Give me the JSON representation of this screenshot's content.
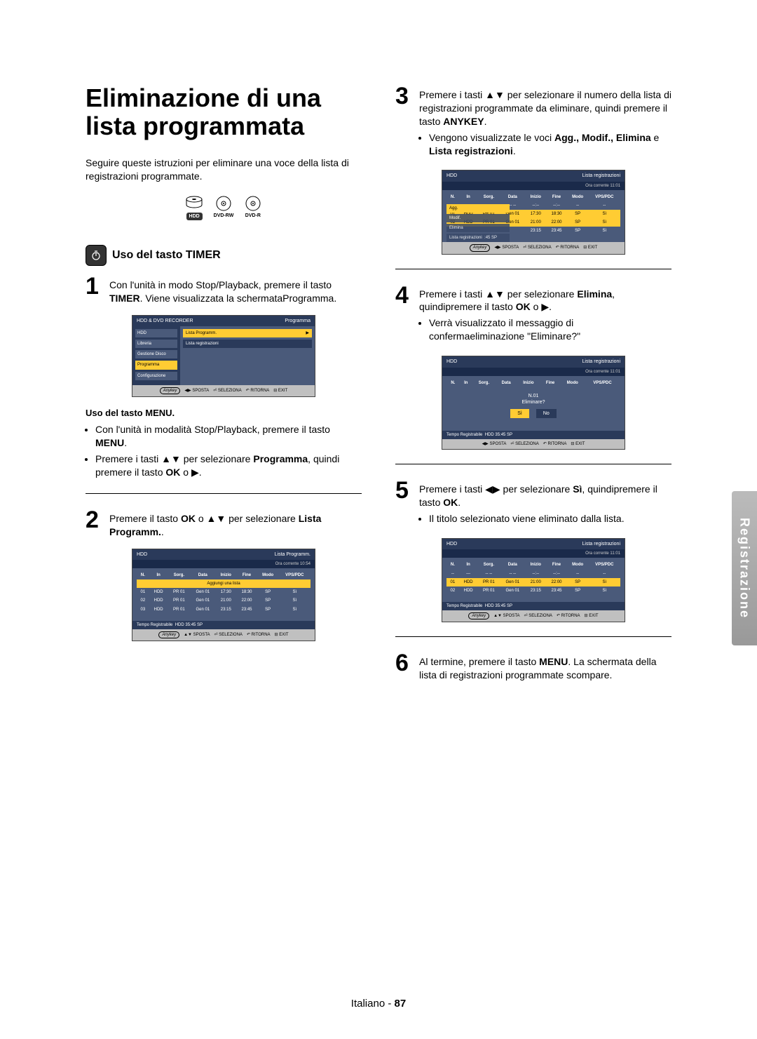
{
  "title": "Eliminazione di una lista programmata",
  "intro": "Seguire queste istruzioni per eliminare una voce della lista di registrazioni programmate.",
  "discs": {
    "hdd": "HDD",
    "dvdrw": "DVD-RW",
    "dvdr": "DVD-R"
  },
  "section_timer": "Uso del tasto TIMER",
  "section_menu_title": "Uso del tasto MENU.",
  "side_tab": "Registrazione",
  "footer_lang": "Italiano -",
  "footer_page": "87",
  "steps": {
    "s1": {
      "text": "Con l'unità in modo Stop/Playback, premere il tasto ",
      "b1": "TIMER",
      "text2": ". Viene visualizzata la schermataProgramma."
    },
    "menu_bullets": {
      "b1a": "Con l'unità in modalità Stop/Playback, premere il tasto ",
      "b1b": "MENU",
      "b1c": ".",
      "b2a": "Premere i tasti ▲▼ per selezionare ",
      "b2b": "Programma",
      "b2c": ", quindi premere il tasto ",
      "b2d": "OK",
      "b2e": " o ▶."
    },
    "s2": {
      "a": "Premere il tasto ",
      "b": "OK",
      "c": " o ▲▼ per selezionare ",
      "d": "Lista Programm.",
      "e": "."
    },
    "s3": {
      "a": "Premere i tasti ▲▼ per selezionare il numero della lista di registrazioni programmate da eliminare, quindi premere il tasto ",
      "b": "ANYKEY",
      "c": ".",
      "bullet_a": "Vengono visualizzate le voci ",
      "bullet_b": "Agg., Modif., Elimina",
      "bullet_c": " e ",
      "bullet_d": "Lista registrazioni",
      "bullet_e": "."
    },
    "s4": {
      "a": "Premere i tasti ▲▼ per selezionare ",
      "b": "Elimina",
      "c": ", quindipremere il tasto ",
      "d": "OK",
      "e": " o ▶.",
      "bullet": "Verrà visualizzato il messaggio di confermaeliminazione \"Eliminare?\""
    },
    "s5": {
      "a": "Premere i tasti ◀▶ per selezionare ",
      "b": "Sì",
      "c": ", quindipremere il tasto ",
      "d": "OK",
      "e": ".",
      "bullet": "Il titolo selezionato viene eliminato dalla lista."
    },
    "s6": {
      "a": "Al termine, premere il tasto ",
      "b": "MENU",
      "c": ". La schermata della lista di registrazioni programmate scompare."
    }
  },
  "osd": {
    "foot_sposta": "SPOSTA",
    "foot_seleziona": "SELEZIONA",
    "foot_ritorna": "RITORNA",
    "foot_exit": "EXIT",
    "anykey": "Anykey",
    "headers": [
      "N.",
      "In",
      "Sorg.",
      "Data",
      "Inizio",
      "Fine",
      "Modo",
      "VPS/PDC"
    ],
    "tempo_label": "Tempo Registrabile",
    "tempo_value": "HDD  35:45 SP",
    "screen1": {
      "title": "HDD & DVD RECORDER",
      "right": "Programma",
      "side": [
        "HDD",
        "Libreria",
        "Gestione Disco",
        "Programma",
        "Configurazione"
      ],
      "rows": [
        "Lista Programm.",
        "Lista registrazioni"
      ]
    },
    "screen2": {
      "title_l": "HDD",
      "title_r": "Lista Programm.",
      "time": "Ora corrente 10:54",
      "addrow": "Aggiungi una lista",
      "rows": [
        [
          "01",
          "HDD",
          "PR 01",
          "Gen 01",
          "17:30",
          "18:30",
          "SP",
          "Sì"
        ],
        [
          "02",
          "HDD",
          "PR 01",
          "Gen 01",
          "21:00",
          "22:00",
          "SP",
          "Sì"
        ],
        [
          "03",
          "HDD",
          "PR 01",
          "Gen 01",
          "23:15",
          "23:45",
          "SP",
          "Sì"
        ]
      ]
    },
    "screen3": {
      "title_l": "HDD",
      "title_r": "Lista registrazioni",
      "time": "Ora corrente 11:01",
      "menu": [
        "Agg.",
        "Modif.",
        "Elimina",
        "Lista registrazioni"
      ],
      "menu_tail": ":45 SP",
      "rows": [
        [
          "--",
          "---",
          "-- --",
          "-- --",
          "--:--",
          "--:--",
          "--",
          "--"
        ],
        [
          "01",
          "HDD",
          "PR 01",
          "Gen 01",
          "17:30",
          "18:30",
          "SP",
          "Sì"
        ],
        [
          "02",
          "HDD",
          "PR 01",
          "Gen 01",
          "21:00",
          "22:00",
          "SP",
          "Sì"
        ],
        [
          "",
          "",
          "",
          "",
          "23:15",
          "23:45",
          "SP",
          "Sì"
        ]
      ]
    },
    "screen4": {
      "title_l": "HDD",
      "title_r": "Lista registrazioni",
      "time": "Ora corrente 11:01",
      "confirm_n": "N.01",
      "confirm_q": "Eliminare?",
      "yes": "Sì",
      "no": "No"
    },
    "screen5": {
      "title_l": "HDD",
      "title_r": "Lista registrazioni",
      "time": "Ora corrente 11:01",
      "rows": [
        [
          "--",
          "---",
          "-- --",
          "-- --",
          "--:--",
          "--:--",
          "--",
          "--"
        ],
        [
          "01",
          "HDD",
          "PR 01",
          "Gen 01",
          "21:00",
          "22:00",
          "SP",
          "Sì"
        ],
        [
          "02",
          "HDD",
          "PR 01",
          "Gen 01",
          "23:15",
          "23:45",
          "SP",
          "Sì"
        ]
      ]
    }
  }
}
